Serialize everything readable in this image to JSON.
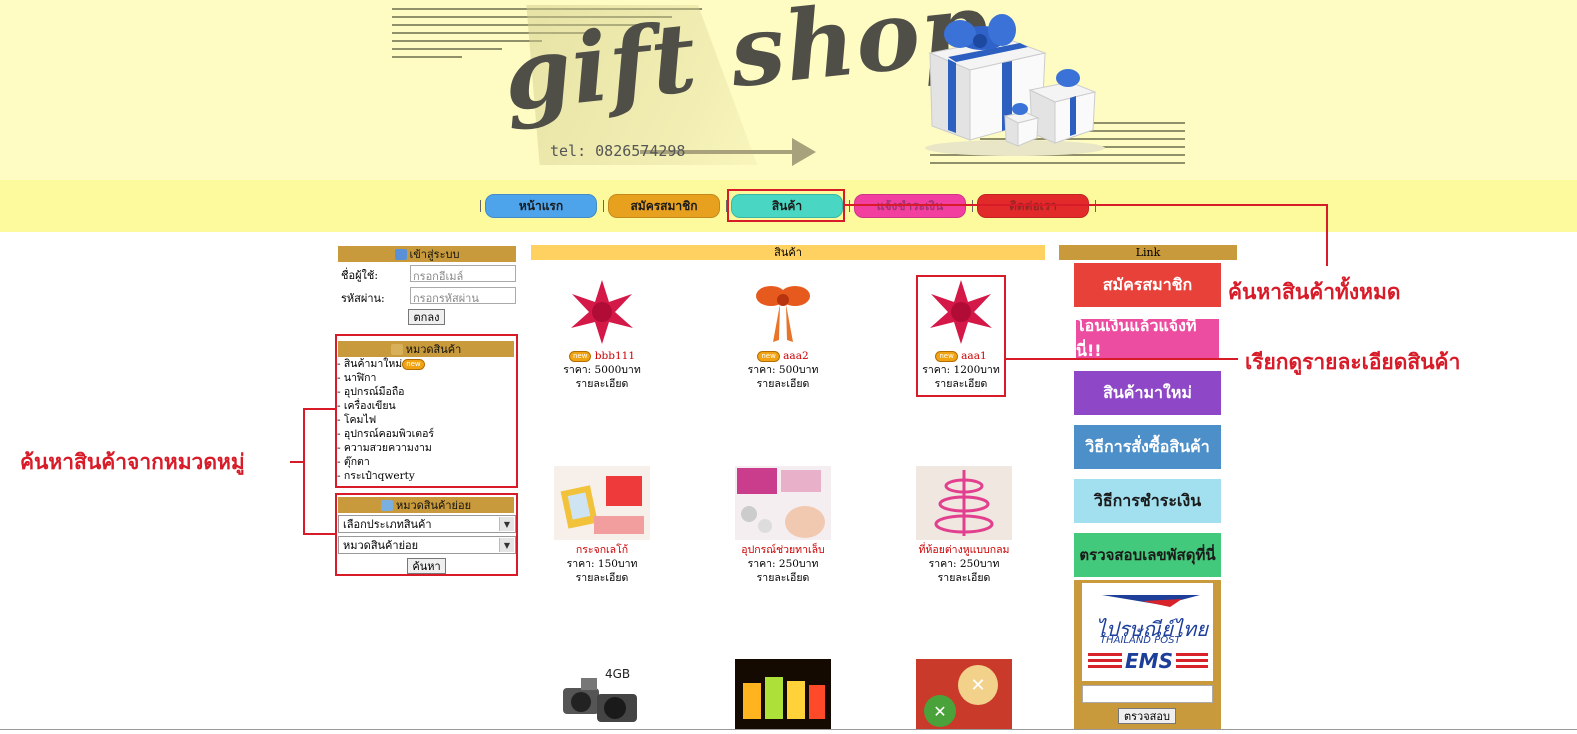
{
  "header": {
    "logo_text": "gift shop",
    "tel": "tel: 0826574298"
  },
  "nav": {
    "items": [
      {
        "label": "หน้าแรก",
        "color": "#4ea4ea"
      },
      {
        "label": "สมัครสมาชิก",
        "color": "#e7a11f"
      },
      {
        "label": "สินค้า",
        "color": "#49d6c2"
      },
      {
        "label": "แจ้งชำระเงิน",
        "color": "#f23f9f"
      },
      {
        "label": "ติดต่อเรา",
        "color": "#e32a2a"
      }
    ]
  },
  "login": {
    "title": "เข้าสู่ระบบ",
    "username_label": "ชื่อผู้ใช้:",
    "username_placeholder": "กรอกอีเมล์",
    "password_label": "รหัสผ่าน:",
    "password_placeholder": "กรอกรหัสผ่าน",
    "submit_label": "ตกลง"
  },
  "categories": {
    "title": "หมวดสินค้า",
    "new_badge": "new",
    "items": [
      "- สินค้ามาใหม่",
      "- นาฬิกา",
      "- อุปกรณ์มือถือ",
      "- เครื่องเขียน",
      "- โคมไฟ",
      "- อุปกรณ์คอมพิวเตอร์",
      "- ความสวยความงาม",
      "- ตุ๊กตา",
      "- กระเป๋าqwerty"
    ]
  },
  "subcategory": {
    "title": "หมวดสินค้าย่อย",
    "type_select": "เลือกประเภทสินค้า",
    "sub_select": "หมวดสินค้าย่อย",
    "search_label": "ค้นหา"
  },
  "products": {
    "title": "สินค้า",
    "items": [
      {
        "name": "bbb111",
        "price": "ราคา: 5000บาท",
        "detail": "รายละเอียด",
        "is_new": true
      },
      {
        "name": "aaa2",
        "price": "ราคา: 500บาท",
        "detail": "รายละเอียด",
        "is_new": true
      },
      {
        "name": "aaa1",
        "price": "ราคา: 1200บาท",
        "detail": "รายละเอียด",
        "is_new": true
      },
      {
        "name": "กระจกเลโก้",
        "price": "ราคา: 150บาท",
        "detail": "รายละเอียด",
        "is_new": false
      },
      {
        "name": "อุปกรณ์ช่วยทาเล็บ",
        "price": "ราคา: 250บาท",
        "detail": "รายละเอียด",
        "is_new": false
      },
      {
        "name": "ที่ห้อยต่างหูแบบกลม",
        "price": "ราคา: 250บาท",
        "detail": "รายละเอียด",
        "is_new": false
      }
    ],
    "camera_label": "4GB"
  },
  "links": {
    "title": "Link",
    "banners": [
      {
        "label": "สมัครสมาชิก",
        "bg": "#e8413a",
        "fg": "#ffffff"
      },
      {
        "label": "โอนเงินแล้วแจ้งที่นี่!!",
        "bg": "#ec4da0",
        "fg": "#ffffff"
      },
      {
        "label": "สินค้ามาใหม่",
        "bg": "#8e48c7",
        "fg": "#ffffff"
      },
      {
        "label": "วิธีการสั่งซื้อสินค้า",
        "bg": "#4d8fc9",
        "fg": "#ffffff"
      },
      {
        "label": "วิธีการชำระเงิน",
        "bg": "#a3e0ef",
        "fg": "#1a1a1a"
      },
      {
        "label": "ตรวจสอบเลขพัสดุที่นี่",
        "bg": "#43c97b",
        "fg": "#1a1a1a"
      }
    ],
    "post_logo_thai": "ไปรษณีย์ไทย",
    "post_logo_en": "THAILAND POST",
    "ems_text": "EMS",
    "track_button": "ตรวจสอบ"
  },
  "annotations": {
    "search_all": "ค้นหาสินค้าทั้งหมด",
    "view_detail": "เรียกดูรายละเอียดสินค้า",
    "search_category": "ค้นหาสินค้าจากหมวดหมู่"
  }
}
